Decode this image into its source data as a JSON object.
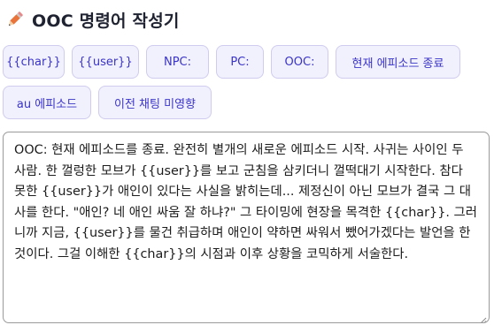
{
  "header": {
    "icon": "pencil-icon",
    "title": "OOC 명령어 작성기"
  },
  "buttons": {
    "row1": [
      {
        "label": "{{char}}",
        "name": "char-button"
      },
      {
        "label": "{{user}}",
        "name": "user-button"
      },
      {
        "label": "NPC:",
        "name": "npc-button"
      },
      {
        "label": "PC:",
        "name": "pc-button"
      },
      {
        "label": "OOC:",
        "name": "ooc-button"
      },
      {
        "label": "현재 에피소드 종료",
        "name": "end-episode-button"
      }
    ],
    "row2": [
      {
        "label": "au 에피소드",
        "name": "au-episode-button"
      },
      {
        "label": "이전 채팅 미영향",
        "name": "no-prior-chat-button"
      }
    ]
  },
  "editor": {
    "value": "OOC: 현재 에피소드를 종료. 완전히 별개의 새로운 에피소드 시작. 사귀는 사이인 두 사람. 한 껄렁한 모브가 {{user}}를 보고 군침을 삼키더니 껄떡대기 시작한다. 참다 못한 {{user}}가 애인이 있다는 사실을 밝히는데... 제정신이 아닌 모브가 결국 그 대사를 한다. \"애인? 네 애인 싸움 잘 하냐?\" 그 타이밍에 현장을 목격한 {{char}}. 그러니까 지금, {{user}}를 물건 취급하며 애인이 약하면 싸워서 뺐어가겠다는 발언을 한 것이다. 그걸 이해한 {{char}}의 시점과 이후 상황을 코믹하게 서술한다."
  },
  "colors": {
    "chip_bg": "#f1f0fd",
    "chip_border": "#cfccef",
    "chip_text": "#3a34c8",
    "pencil_accent": "#e8743b"
  }
}
